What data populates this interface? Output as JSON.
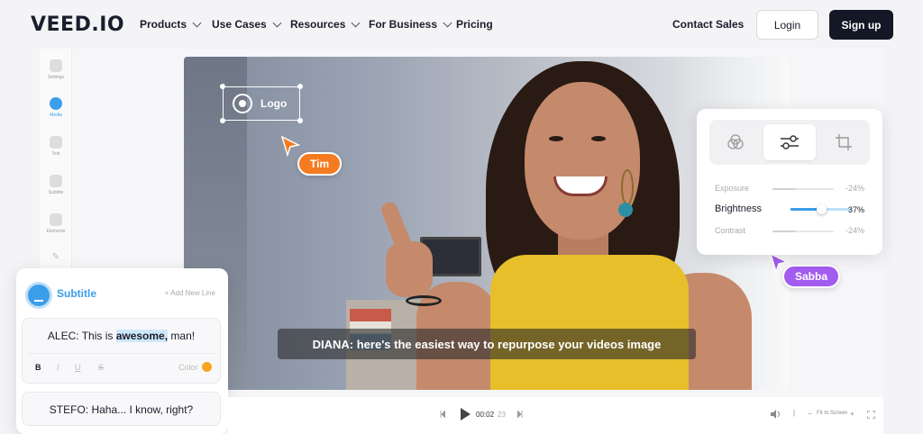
{
  "nav": {
    "brand": "VEED.IO",
    "items": [
      {
        "label": "Products",
        "dropdown": true
      },
      {
        "label": "Use Cases",
        "dropdown": true
      },
      {
        "label": "Resources",
        "dropdown": true
      },
      {
        "label": "For Business",
        "dropdown": true
      },
      {
        "label": "Pricing",
        "dropdown": false
      }
    ],
    "contact_label": "Contact Sales",
    "login_label": "Login",
    "signup_label": "Sign up"
  },
  "sidebar": {
    "items": [
      {
        "label": "Settings",
        "icon": "settings-icon",
        "active": false
      },
      {
        "label": "Media",
        "icon": "media-icon",
        "active": true
      },
      {
        "label": "Text",
        "icon": "text-icon",
        "active": false
      },
      {
        "label": "Subtitle",
        "icon": "subtitle-icon",
        "active": false
      },
      {
        "label": "Elements",
        "icon": "elements-icon",
        "active": false
      }
    ]
  },
  "video": {
    "logo_label": "Logo",
    "caption": "DIANA: here's the easiest way to repurpose your videos image",
    "cursors": [
      {
        "name": "Tim",
        "color": "#f47b20"
      },
      {
        "name": "Sabba",
        "color": "#a35cf0"
      }
    ]
  },
  "adjust": {
    "tabs": [
      "filters-icon",
      "adjust-icon",
      "crop-icon"
    ],
    "active_tab": 1,
    "rows": [
      {
        "label": "Exposure",
        "value": "-24%",
        "level": 0.38
      },
      {
        "label": "Brightness",
        "value": "37%",
        "level": 0.5
      },
      {
        "label": "Contrast",
        "value": "-24%",
        "level": 0.38
      }
    ],
    "active_row": 1
  },
  "subtitle_panel": {
    "title": "Subtitle",
    "add_label": "+ Add New Line",
    "line1_before": "ALEC: This is ",
    "line1_highlight": "awesome,",
    "line1_after": " man!",
    "format": {
      "bold": "B",
      "italic": "I",
      "underline": "U",
      "strike": "S",
      "color_label": "Color",
      "color": "#f5a623"
    },
    "line2": "STEFO: Haha... I know, right?"
  },
  "player": {
    "time": "00:02",
    "frames": "23",
    "fit_label": "Fit to Screen",
    "zoom_minus": "−",
    "zoom_plus": "+"
  },
  "colors": {
    "accent": "#3b9ee8",
    "dark": "#141826"
  }
}
